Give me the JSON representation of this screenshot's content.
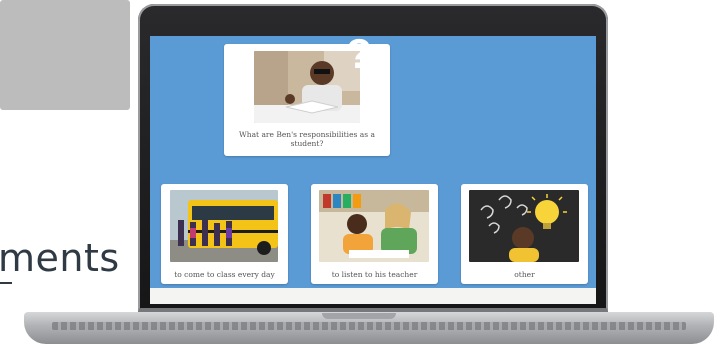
{
  "background_text": "ments",
  "prompt_card": {
    "image_icon": "student-reading-icon",
    "question": "What are Ben's responsibilities as a student?"
  },
  "hidden_card": {
    "mark": "?"
  },
  "answers": [
    {
      "label": "to come to class every day",
      "image_icon": "school-bus-icon"
    },
    {
      "label": "to listen to his teacher",
      "image_icon": "teacher-student-icon"
    },
    {
      "label": "other",
      "image_icon": "lightbulb-idea-icon"
    }
  ],
  "colors": {
    "screen_bg": "#5b9bd5",
    "card_bg": "#ffffff",
    "hidden_card_bg": "#bcbcbc",
    "text": "#555555"
  }
}
